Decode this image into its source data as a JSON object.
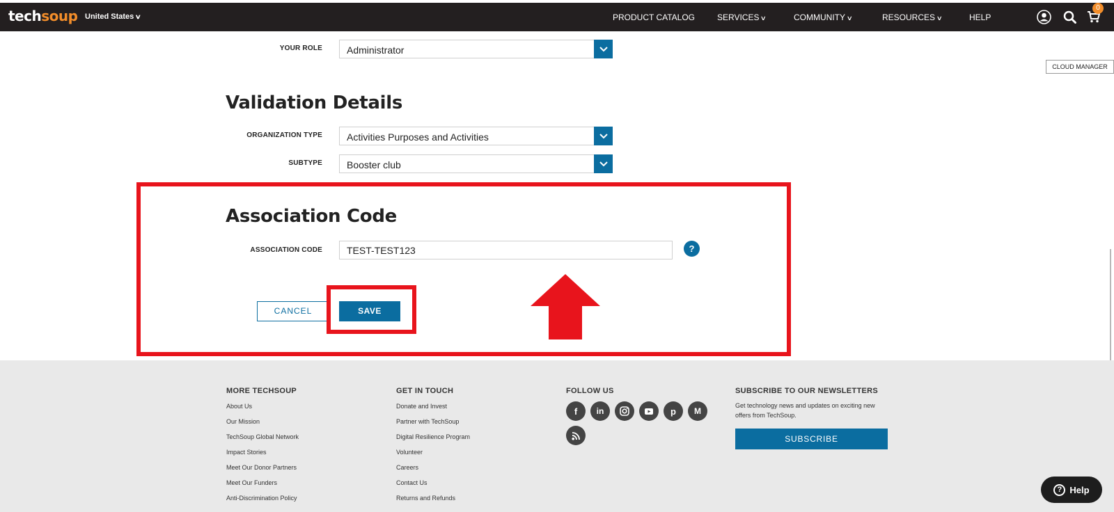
{
  "header": {
    "logo_tech": "tech",
    "logo_soup": "soup",
    "country": "United States",
    "nav": [
      {
        "label": "PRODUCT CATALOG",
        "dropdown": false
      },
      {
        "label": "SERVICES",
        "dropdown": true
      },
      {
        "label": "COMMUNITY",
        "dropdown": true
      },
      {
        "label": "RESOURCES",
        "dropdown": true
      },
      {
        "label": "HELP",
        "dropdown": false
      }
    ],
    "icons": [
      "account-icon",
      "search-icon",
      "cart-icon"
    ],
    "cart_count": "0"
  },
  "cloud_manager": "CLOUD MANAGER",
  "form": {
    "role": {
      "label": "YOUR ROLE",
      "value": "Administrator"
    },
    "validation": {
      "title": "Validation Details",
      "org_type": {
        "label": "ORGANIZATION TYPE",
        "value": "Activities Purposes and Activities"
      },
      "subtype": {
        "label": "SUBTYPE",
        "value": "Booster club"
      }
    },
    "association": {
      "title": "Association Code",
      "label": "ASSOCIATION CODE",
      "value": "TEST-TEST123",
      "help": "?"
    },
    "cancel_label": "CANCEL",
    "save_label": "SAVE"
  },
  "footer": {
    "more": {
      "title": "MORE TECHSOUP",
      "links": [
        "About Us",
        "Our Mission",
        "TechSoup Global Network",
        "Impact Stories",
        "Meet Our Donor Partners",
        "Meet Our Funders",
        "Anti-Discrimination Policy"
      ]
    },
    "contact": {
      "title": "GET IN TOUCH",
      "links": [
        "Donate and Invest",
        "Partner with TechSoup",
        "Digital Resilience Program",
        "Volunteer",
        "Careers",
        "Contact Us",
        "Returns and Refunds"
      ]
    },
    "follow": {
      "title": "FOLLOW US",
      "icons": [
        "facebook-icon",
        "linkedin-icon",
        "instagram-icon",
        "youtube-icon",
        "pinterest-icon",
        "medium-icon",
        "rss-icon"
      ]
    },
    "newsletter": {
      "title": "SUBSCRIBE TO OUR NEWSLETTERS",
      "text": "Get technology news and updates on exciting new offers from TechSoup.",
      "button": "SUBSCRIBE"
    }
  },
  "help_widget": "Help",
  "colors": {
    "topbar": "#231f20",
    "brand_orange": "#f28d2a",
    "primary_blue": "#0b6da0",
    "highlight_red": "#e8141c",
    "footer_bg": "#e9e9e9"
  }
}
